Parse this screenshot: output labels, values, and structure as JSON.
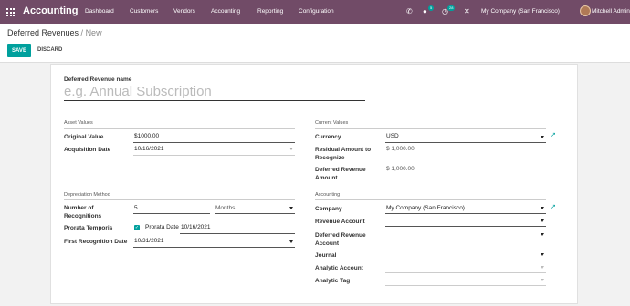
{
  "topbar": {
    "app_name": "Accounting",
    "menu": [
      "Dashboard",
      "Customers",
      "Vendors",
      "Accounting",
      "Reporting",
      "Configuration"
    ],
    "chat_count": "5",
    "activity_count": "28",
    "company": "My Company (San Francisco)",
    "user": "Mitchell Admin"
  },
  "breadcrumb": {
    "parent": "Deferred Revenues",
    "separator": " / ",
    "current": "New"
  },
  "buttons": {
    "save": "SAVE",
    "discard": "DISCARD"
  },
  "form": {
    "name_label": "Deferred Revenue name",
    "name_placeholder": "e.g. Annual Subscription",
    "asset_values": {
      "title": "Asset Values",
      "original_value_label": "Original Value",
      "original_value": "$1000.00",
      "acquisition_date_label": "Acquisition Date",
      "acquisition_date": "10/16/2021"
    },
    "current_values": {
      "title": "Current Values",
      "currency_label": "Currency",
      "currency": "USD",
      "residual_label_1": "Residual Amount to",
      "residual_label_2": "Recognize",
      "residual_value": "$ 1,000.00",
      "deferred_amount_label_1": "Deferred Revenue",
      "deferred_amount_label_2": "Amount",
      "deferred_amount_value": "$ 1,000.00"
    },
    "depreciation": {
      "title": "Depreciation Method",
      "number_label_1": "Number of",
      "number_label_2": "Recognitions",
      "number_value": "5",
      "period": "Months",
      "prorata_label": "Prorata Temporis",
      "prorata_date_label": "Prorata Date",
      "prorata_date": "10/16/2021",
      "first_date_label": "First Recognition Date",
      "first_date": "10/31/2021"
    },
    "accounting": {
      "title": "Accounting",
      "company_label": "Company",
      "company_value": "My Company (San Francisco)",
      "revenue_account_label": "Revenue Account",
      "deferred_account_label_1": "Deferred Revenue",
      "deferred_account_label_2": "Account",
      "journal_label": "Journal",
      "analytic_account_label": "Analytic Account",
      "analytic_tag_label": "Analytic Tag"
    }
  }
}
